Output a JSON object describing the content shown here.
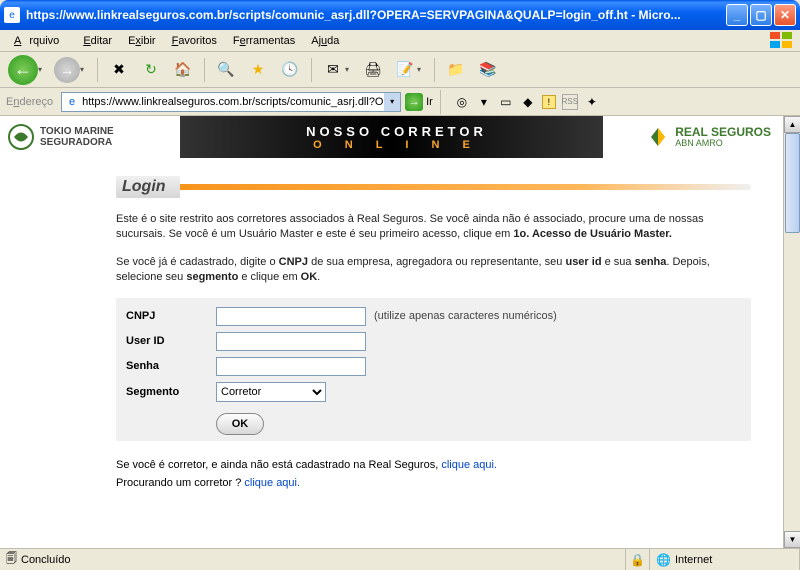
{
  "window": {
    "title": "https://www.linkrealseguros.com.br/scripts/comunic_asrj.dll?OPERA=SERVPAGINA&QUALP=login_off.ht - Micro..."
  },
  "menu": {
    "arquivo": "Arquivo",
    "editar": "Editar",
    "exibir": "Exibir",
    "favoritos": "Favoritos",
    "ferramentas": "Ferramentas",
    "ajuda": "Ajuda"
  },
  "address": {
    "label": "Endereço",
    "value": "https://www.linkrealseguros.com.br/scripts/comunic_asrj.dll?OPERA=S",
    "go": "Ir"
  },
  "banner": {
    "left_line1": "TOKIO MARINE",
    "left_line2": "SEGURADORA",
    "center_line1": "NOSSO CORRETOR",
    "center_line2": "O N L I N E",
    "right_line1": "REAL SEGUROS",
    "right_line2": "ABN AMRO"
  },
  "page": {
    "heading": "Login",
    "para1_a": "Este é o site restrito aos corretores associados à Real Seguros. Se você ainda não é associado, procure uma de nossas sucursais. Se você é um Usuário Master e este é seu primeiro acesso, clique em ",
    "para1_b": "1o. Acesso de Usuário Master.",
    "para2_a": "Se você já é cadastrado, digite o ",
    "para2_b": "CNPJ",
    "para2_c": " de sua empresa, agregadora ou representante, seu ",
    "para2_d": "user id",
    "para2_e": " e sua ",
    "para2_f": "senha",
    "para2_g": ". Depois, selecione seu ",
    "para2_h": "segmento",
    "para2_i": " e clique em ",
    "para2_j": "OK",
    "para2_k": ".",
    "form": {
      "cnpj_label": "CNPJ",
      "cnpj_hint": "(utilize apenas caracteres numéricos)",
      "userid_label": "User ID",
      "senha_label": "Senha",
      "segmento_label": "Segmento",
      "segmento_value": "Corretor",
      "ok": "OK"
    },
    "footer1_a": "Se você é corretor, e ainda não está cadastrado na Real Seguros, ",
    "footer1_link": "clique aqui.",
    "footer2_a": "Procurando um corretor ? ",
    "footer2_link": "clique aqui."
  },
  "status": {
    "text": "Concluído",
    "zone": "Internet"
  }
}
